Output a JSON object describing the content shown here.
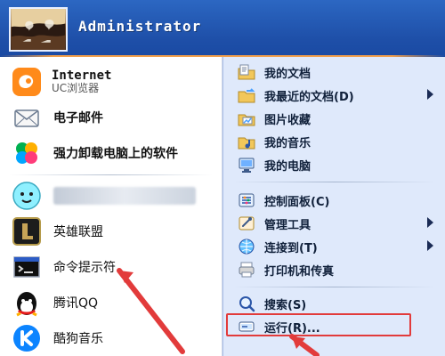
{
  "header": {
    "username": "Administrator"
  },
  "left_panel": {
    "items": [
      {
        "primary": "Internet",
        "secondary": "UC浏览器",
        "icon": "uc-browser-icon"
      },
      {
        "label": "电子邮件",
        "icon": "email-icon"
      },
      {
        "label": "强力卸载电脑上的软件",
        "icon": "uninstaller-icon"
      },
      {
        "label": "",
        "icon": "qq-face-icon"
      },
      {
        "label": "英雄联盟",
        "icon": "league-of-legends-icon"
      },
      {
        "label": "命令提示符",
        "icon": "command-prompt-icon"
      },
      {
        "label": "腾讯QQ",
        "icon": "tencent-qq-icon"
      },
      {
        "label": "酷狗音乐",
        "icon": "kugou-music-icon"
      }
    ]
  },
  "right_panel": {
    "items": [
      {
        "label": "我的文档",
        "icon": "my-documents-icon"
      },
      {
        "label": "我最近的文档(D)",
        "icon": "recent-documents-icon",
        "has_submenu": true
      },
      {
        "label": "图片收藏",
        "icon": "my-pictures-icon"
      },
      {
        "label": "我的音乐",
        "icon": "my-music-icon"
      },
      {
        "label": "我的电脑",
        "icon": "my-computer-icon"
      },
      {
        "label": "控制面板(C)",
        "icon": "control-panel-icon"
      },
      {
        "label": "管理工具",
        "icon": "admin-tools-icon",
        "has_submenu": true
      },
      {
        "label": "连接到(T)",
        "icon": "connect-to-icon",
        "has_submenu": true
      },
      {
        "label": "打印机和传真",
        "icon": "printers-faxes-icon"
      },
      {
        "label": "搜索(S)",
        "icon": "search-icon"
      },
      {
        "label": "运行(R)...",
        "icon": "run-icon"
      }
    ]
  },
  "colors": {
    "header_blue": "#1e4fa8",
    "right_panel_bg": "#dfe9fb",
    "highlight_red": "#e23b3b",
    "accent_orange": "#ffa546"
  }
}
